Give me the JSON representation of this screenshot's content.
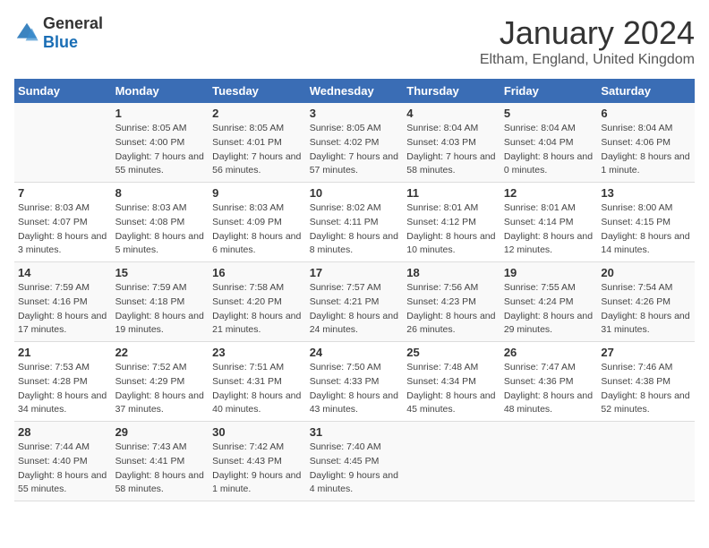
{
  "logo": {
    "text_general": "General",
    "text_blue": "Blue"
  },
  "title": "January 2024",
  "subtitle": "Eltham, England, United Kingdom",
  "days_header": [
    "Sunday",
    "Monday",
    "Tuesday",
    "Wednesday",
    "Thursday",
    "Friday",
    "Saturday"
  ],
  "weeks": [
    [
      {
        "day": "",
        "sunrise": "",
        "sunset": "",
        "daylight": ""
      },
      {
        "day": "1",
        "sunrise": "Sunrise: 8:05 AM",
        "sunset": "Sunset: 4:00 PM",
        "daylight": "Daylight: 7 hours and 55 minutes."
      },
      {
        "day": "2",
        "sunrise": "Sunrise: 8:05 AM",
        "sunset": "Sunset: 4:01 PM",
        "daylight": "Daylight: 7 hours and 56 minutes."
      },
      {
        "day": "3",
        "sunrise": "Sunrise: 8:05 AM",
        "sunset": "Sunset: 4:02 PM",
        "daylight": "Daylight: 7 hours and 57 minutes."
      },
      {
        "day": "4",
        "sunrise": "Sunrise: 8:04 AM",
        "sunset": "Sunset: 4:03 PM",
        "daylight": "Daylight: 7 hours and 58 minutes."
      },
      {
        "day": "5",
        "sunrise": "Sunrise: 8:04 AM",
        "sunset": "Sunset: 4:04 PM",
        "daylight": "Daylight: 8 hours and 0 minutes."
      },
      {
        "day": "6",
        "sunrise": "Sunrise: 8:04 AM",
        "sunset": "Sunset: 4:06 PM",
        "daylight": "Daylight: 8 hours and 1 minute."
      }
    ],
    [
      {
        "day": "7",
        "sunrise": "Sunrise: 8:03 AM",
        "sunset": "Sunset: 4:07 PM",
        "daylight": "Daylight: 8 hours and 3 minutes."
      },
      {
        "day": "8",
        "sunrise": "Sunrise: 8:03 AM",
        "sunset": "Sunset: 4:08 PM",
        "daylight": "Daylight: 8 hours and 5 minutes."
      },
      {
        "day": "9",
        "sunrise": "Sunrise: 8:03 AM",
        "sunset": "Sunset: 4:09 PM",
        "daylight": "Daylight: 8 hours and 6 minutes."
      },
      {
        "day": "10",
        "sunrise": "Sunrise: 8:02 AM",
        "sunset": "Sunset: 4:11 PM",
        "daylight": "Daylight: 8 hours and 8 minutes."
      },
      {
        "day": "11",
        "sunrise": "Sunrise: 8:01 AM",
        "sunset": "Sunset: 4:12 PM",
        "daylight": "Daylight: 8 hours and 10 minutes."
      },
      {
        "day": "12",
        "sunrise": "Sunrise: 8:01 AM",
        "sunset": "Sunset: 4:14 PM",
        "daylight": "Daylight: 8 hours and 12 minutes."
      },
      {
        "day": "13",
        "sunrise": "Sunrise: 8:00 AM",
        "sunset": "Sunset: 4:15 PM",
        "daylight": "Daylight: 8 hours and 14 minutes."
      }
    ],
    [
      {
        "day": "14",
        "sunrise": "Sunrise: 7:59 AM",
        "sunset": "Sunset: 4:16 PM",
        "daylight": "Daylight: 8 hours and 17 minutes."
      },
      {
        "day": "15",
        "sunrise": "Sunrise: 7:59 AM",
        "sunset": "Sunset: 4:18 PM",
        "daylight": "Daylight: 8 hours and 19 minutes."
      },
      {
        "day": "16",
        "sunrise": "Sunrise: 7:58 AM",
        "sunset": "Sunset: 4:20 PM",
        "daylight": "Daylight: 8 hours and 21 minutes."
      },
      {
        "day": "17",
        "sunrise": "Sunrise: 7:57 AM",
        "sunset": "Sunset: 4:21 PM",
        "daylight": "Daylight: 8 hours and 24 minutes."
      },
      {
        "day": "18",
        "sunrise": "Sunrise: 7:56 AM",
        "sunset": "Sunset: 4:23 PM",
        "daylight": "Daylight: 8 hours and 26 minutes."
      },
      {
        "day": "19",
        "sunrise": "Sunrise: 7:55 AM",
        "sunset": "Sunset: 4:24 PM",
        "daylight": "Daylight: 8 hours and 29 minutes."
      },
      {
        "day": "20",
        "sunrise": "Sunrise: 7:54 AM",
        "sunset": "Sunset: 4:26 PM",
        "daylight": "Daylight: 8 hours and 31 minutes."
      }
    ],
    [
      {
        "day": "21",
        "sunrise": "Sunrise: 7:53 AM",
        "sunset": "Sunset: 4:28 PM",
        "daylight": "Daylight: 8 hours and 34 minutes."
      },
      {
        "day": "22",
        "sunrise": "Sunrise: 7:52 AM",
        "sunset": "Sunset: 4:29 PM",
        "daylight": "Daylight: 8 hours and 37 minutes."
      },
      {
        "day": "23",
        "sunrise": "Sunrise: 7:51 AM",
        "sunset": "Sunset: 4:31 PM",
        "daylight": "Daylight: 8 hours and 40 minutes."
      },
      {
        "day": "24",
        "sunrise": "Sunrise: 7:50 AM",
        "sunset": "Sunset: 4:33 PM",
        "daylight": "Daylight: 8 hours and 43 minutes."
      },
      {
        "day": "25",
        "sunrise": "Sunrise: 7:48 AM",
        "sunset": "Sunset: 4:34 PM",
        "daylight": "Daylight: 8 hours and 45 minutes."
      },
      {
        "day": "26",
        "sunrise": "Sunrise: 7:47 AM",
        "sunset": "Sunset: 4:36 PM",
        "daylight": "Daylight: 8 hours and 48 minutes."
      },
      {
        "day": "27",
        "sunrise": "Sunrise: 7:46 AM",
        "sunset": "Sunset: 4:38 PM",
        "daylight": "Daylight: 8 hours and 52 minutes."
      }
    ],
    [
      {
        "day": "28",
        "sunrise": "Sunrise: 7:44 AM",
        "sunset": "Sunset: 4:40 PM",
        "daylight": "Daylight: 8 hours and 55 minutes."
      },
      {
        "day": "29",
        "sunrise": "Sunrise: 7:43 AM",
        "sunset": "Sunset: 4:41 PM",
        "daylight": "Daylight: 8 hours and 58 minutes."
      },
      {
        "day": "30",
        "sunrise": "Sunrise: 7:42 AM",
        "sunset": "Sunset: 4:43 PM",
        "daylight": "Daylight: 9 hours and 1 minute."
      },
      {
        "day": "31",
        "sunrise": "Sunrise: 7:40 AM",
        "sunset": "Sunset: 4:45 PM",
        "daylight": "Daylight: 9 hours and 4 minutes."
      },
      {
        "day": "",
        "sunrise": "",
        "sunset": "",
        "daylight": ""
      },
      {
        "day": "",
        "sunrise": "",
        "sunset": "",
        "daylight": ""
      },
      {
        "day": "",
        "sunrise": "",
        "sunset": "",
        "daylight": ""
      }
    ]
  ]
}
